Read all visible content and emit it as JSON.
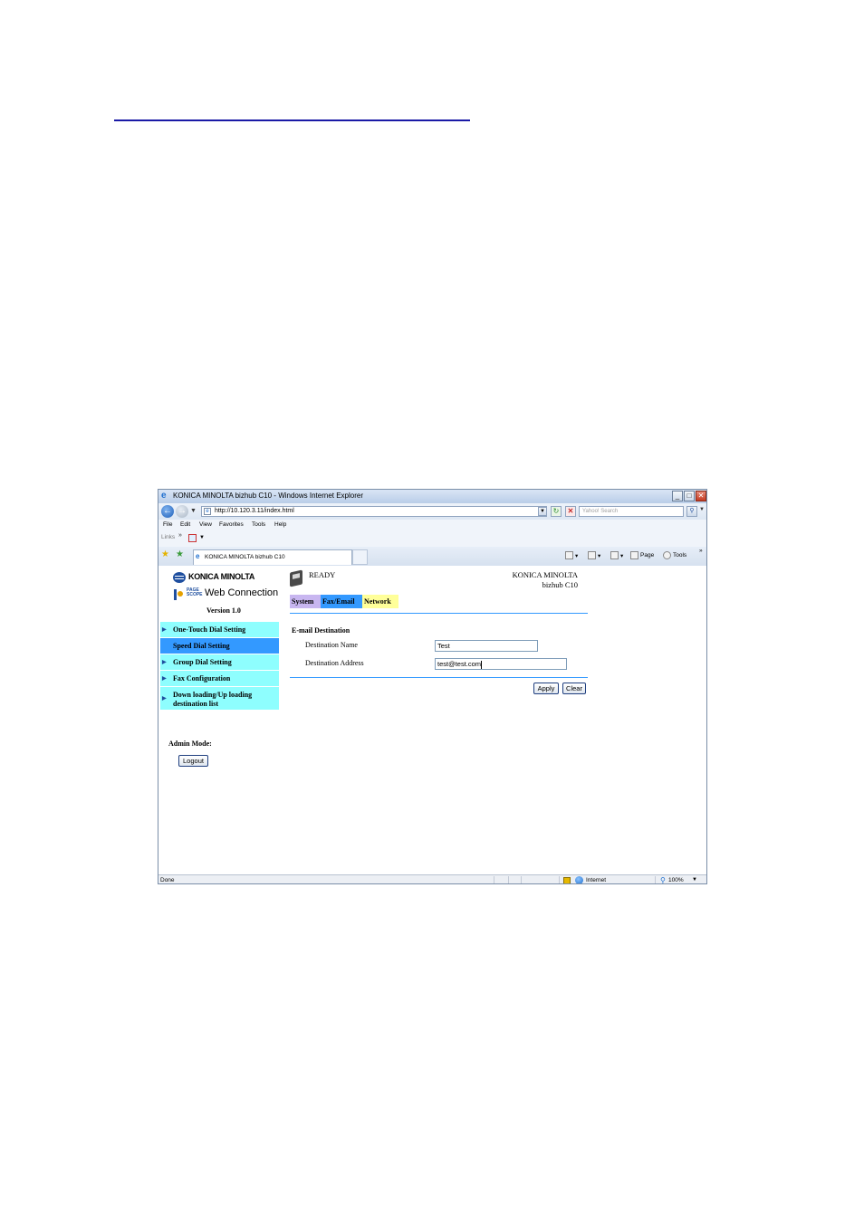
{
  "window": {
    "title": "KONICA MINOLTA bizhub C10 - Windows Internet Explorer",
    "minimize": "_",
    "maximize": "□",
    "close": "✕"
  },
  "addressbar": {
    "url": "http://10.120.3.11/index.html",
    "search_placeholder": "Yahoo! Search"
  },
  "menubar": [
    "File",
    "Edit",
    "View",
    "Favorites",
    "Tools",
    "Help"
  ],
  "linksbar": {
    "label": "Links",
    "chevron": "»"
  },
  "tabbar": {
    "tab_title": "KONICA MINOLTA bizhub C10",
    "page_menu": "Page",
    "tools_menu": "Tools",
    "chevron": "»"
  },
  "app": {
    "logo_text": "KONICA MINOLTA",
    "pagescope_text": "PAGE SCOPE",
    "web_connection": "Web Connection",
    "version": "Version 1.0",
    "status": "READY",
    "brand_line1": "KONICA MINOLTA",
    "brand_line2": "bizhub C10",
    "tabs": [
      {
        "label": "System"
      },
      {
        "label": "Fax/Email"
      },
      {
        "label": "Network"
      }
    ],
    "sidebar": [
      {
        "label": "One-Touch Dial Setting",
        "active": false
      },
      {
        "label": "Speed Dial Setting",
        "active": true
      },
      {
        "label": "Group Dial Setting",
        "active": false
      },
      {
        "label": "Fax Configuration",
        "active": false
      },
      {
        "label": "Down loading/Up loading destination list",
        "active": false
      }
    ],
    "admin_mode": "Admin Mode:",
    "logout": "Logout",
    "section_title": "E-mail Destination",
    "fields": {
      "name_label": "Destination Name",
      "name_value": "Test",
      "address_label": "Destination Address",
      "address_value": "test@test.com"
    },
    "apply": "Apply",
    "clear": "Clear"
  },
  "statusbar": {
    "status": "Done",
    "zone": "Internet",
    "zoom": "100%"
  },
  "colors": {
    "sidebar_bg": "#8efefe",
    "sidebar_active": "#3399ff",
    "tab_system": "#c8b6f0",
    "tab_fax": "#3399ff",
    "tab_network": "#ffff99",
    "divider": "#3399ff"
  }
}
